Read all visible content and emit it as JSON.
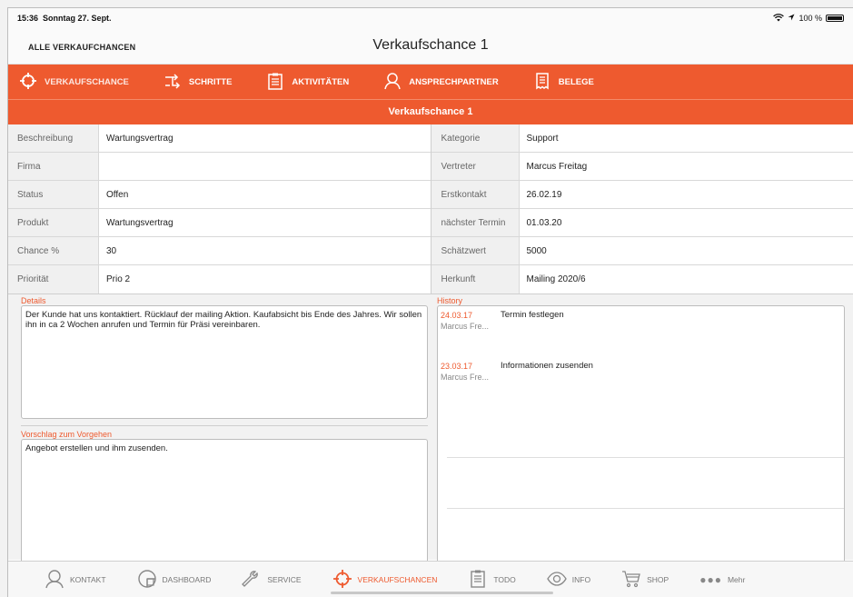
{
  "statusbar": {
    "time": "15:36",
    "date": "Sonntag 27. Sept.",
    "battery": "100 %"
  },
  "nav": {
    "back_label": "ALLE VERKAUFCHANCEN",
    "title": "Verkaufschance 1"
  },
  "tabs": [
    {
      "label": "VERKAUFSCHANCE",
      "icon": "crosshair-icon",
      "active": true
    },
    {
      "label": "SCHRITTE",
      "icon": "steps-arrow-icon"
    },
    {
      "label": "AKTIVITÄTEN",
      "icon": "clipboard-icon"
    },
    {
      "label": "ANSPRECHPARTNER",
      "icon": "person-icon"
    },
    {
      "label": "BELEGE",
      "icon": "receipt-icon"
    }
  ],
  "section_title": "Verkaufschance 1",
  "fields_left": [
    {
      "label": "Beschreibung",
      "value": "Wartungsvertrag"
    },
    {
      "label": "Firma",
      "value": ""
    },
    {
      "label": "Status",
      "value": "Offen"
    },
    {
      "label": "Produkt",
      "value": "Wartungsvertrag"
    },
    {
      "label": "Chance %",
      "value": "30"
    },
    {
      "label": "Priorität",
      "value": "Prio 2"
    }
  ],
  "fields_right": [
    {
      "label": "Kategorie",
      "value": "Support"
    },
    {
      "label": "Vertreter",
      "value": "Marcus Freitag"
    },
    {
      "label": "Erstkontakt",
      "value": "26.02.19"
    },
    {
      "label": "nächster Termin",
      "value": "01.03.20"
    },
    {
      "label": "Schätzwert",
      "value": "5000"
    },
    {
      "label": "Herkunft",
      "value": "Mailing 2020/6"
    }
  ],
  "details": {
    "caption": "Details",
    "text": "Der Kunde hat uns kontaktiert. Rücklauf der mailing Aktion. Kaufabsicht bis Ende des Jahres. Wir sollen ihn in ca 2 Wochen anrufen und Termin für Präsi vereinbaren."
  },
  "vorschlag": {
    "caption": "Vorschlag zum Vorgehen",
    "text": "Angebot erstellen und ihm zusenden."
  },
  "history": {
    "caption": "History",
    "items": [
      {
        "date": "24.03.17",
        "user": "Marcus Fre...",
        "text": "Termin festlegen"
      },
      {
        "date": "23.03.17",
        "user": "Marcus Fre...",
        "text": "Informationen zusenden"
      }
    ]
  },
  "bottom_tabs": [
    {
      "label": "KONTAKT",
      "icon": "person-icon"
    },
    {
      "label": "DASHBOARD",
      "icon": "dashboard-icon"
    },
    {
      "label": "SERVICE",
      "icon": "wrench-icon"
    },
    {
      "label": "VERKAUFSCHANCEN",
      "icon": "crosshair-icon",
      "active": true
    },
    {
      "label": "TODO",
      "icon": "clipboard-icon"
    },
    {
      "label": "INFO",
      "icon": "eye-icon"
    },
    {
      "label": "SHOP",
      "icon": "cart-icon"
    },
    {
      "label": "Mehr",
      "icon": "more-icon"
    }
  ],
  "colors": {
    "accent": "#ee5a2f"
  }
}
